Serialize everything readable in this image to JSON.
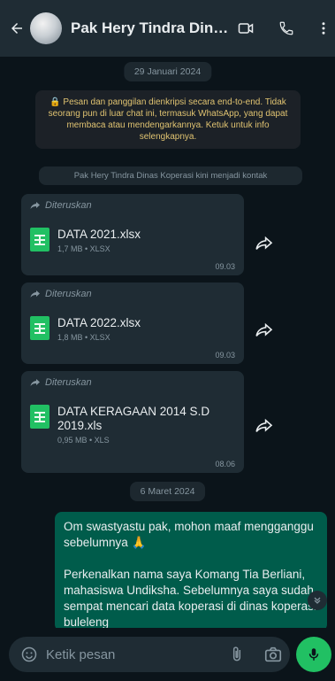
{
  "header": {
    "title": "Pak Hery Tindra Dina...",
    "icons": {
      "back": "arrow-left-icon",
      "video": "video-call-icon",
      "voice": "phone-icon",
      "menu": "more-vertical-icon"
    }
  },
  "chat": {
    "date_1": "29 Januari 2024",
    "encryption_notice": "🔒 Pesan dan panggilan dienkripsi secara end-to-end. Tidak seorang pun di luar chat ini, termasuk WhatsApp, yang dapat membaca atau mendengarkannya. Ketuk untuk info selengkapnya.",
    "contact_note": "Pak Hery Tindra Dinas Koperasi kini menjadi kontak",
    "messages": [
      {
        "forwarded_label": "Diteruskan",
        "file_name": "DATA 2021.xlsx",
        "file_meta": "1,7 MB • XLSX",
        "time": "09.03"
      },
      {
        "forwarded_label": "Diteruskan",
        "file_name": "DATA 2022.xlsx",
        "file_meta": "1,8 MB • XLSX",
        "time": "09.03"
      },
      {
        "forwarded_label": "Diteruskan",
        "file_name": "DATA KERAGAAN 2014 S.D 2019.xls",
        "file_meta": "0,95 MB • XLS",
        "time": "08.06"
      }
    ],
    "date_2": "6 Maret 2024",
    "outgoing_text": "Om swastyastu pak, mohon maaf mengganggu sebelumnya 🙏\n\nPerkenalkan nama saya Komang Tia Berliani, mahasiswa Undiksha. Sebelumnya saya sudah sempat mencari data koperasi di dinas koperasi buleleng"
  },
  "footer": {
    "placeholder": "Ketik pesan",
    "icons": {
      "emoji": "emoji-icon",
      "attach": "paperclip-icon",
      "camera": "camera-icon",
      "mic": "mic-icon"
    }
  },
  "colors": {
    "background": "#0b141a",
    "header": "#1f2c34",
    "incoming_bubble": "#1f2c34",
    "outgoing_bubble": "#005c4b",
    "accent_green": "#21c063",
    "notice_text": "#e0c371"
  }
}
